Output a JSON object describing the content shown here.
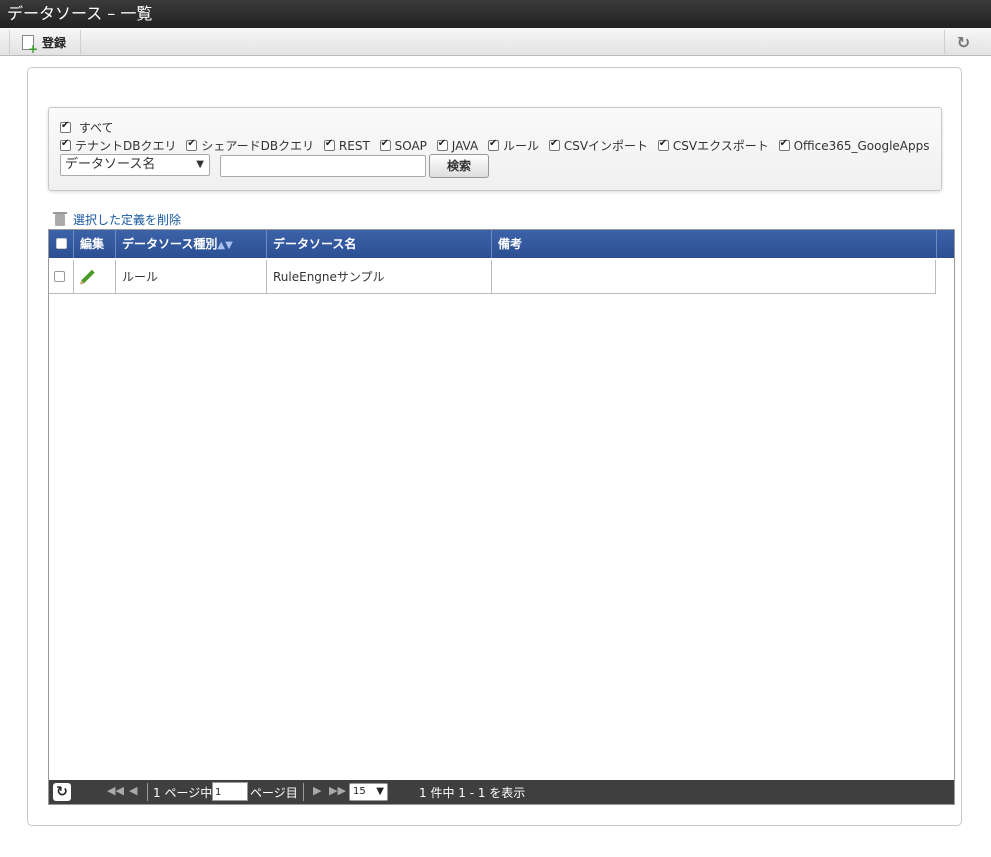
{
  "window": {
    "title": "データソース – 一覧"
  },
  "toolbar": {
    "register_label": "登録"
  },
  "filters": {
    "all_label": "すべて",
    "types": [
      {
        "label": "テナントDBクエリ",
        "checked": true
      },
      {
        "label": "シェアードDBクエリ",
        "checked": true
      },
      {
        "label": "REST",
        "checked": true
      },
      {
        "label": "SOAP",
        "checked": true
      },
      {
        "label": "JAVA",
        "checked": true
      },
      {
        "label": "ルール",
        "checked": true
      },
      {
        "label": "CSVインポート",
        "checked": true
      },
      {
        "label": "CSVエクスポート",
        "checked": true
      },
      {
        "label": "Office365_GoogleApps",
        "checked": true
      }
    ],
    "field_select_value": "データソース名",
    "search_value": "",
    "search_button_label": "検索"
  },
  "actions": {
    "delete_selected_label": "選択した定義を削除"
  },
  "grid": {
    "columns": {
      "edit": "編集",
      "type": "データソース種別",
      "name": "データソース名",
      "note": "備考"
    },
    "rows": [
      {
        "type": "ルール",
        "name": "RuleEngneサンプル",
        "note": ""
      }
    ]
  },
  "pager": {
    "page_prefix": "1 ページ中",
    "page_value": "1",
    "page_suffix": "ページ目",
    "page_size": "15",
    "summary": "1 件中 1 - 1 を表示"
  },
  "colors": {
    "header_blue": "#2c4f93",
    "pager_dark": "#3f3f3f",
    "link_blue": "#1a5aa0"
  }
}
